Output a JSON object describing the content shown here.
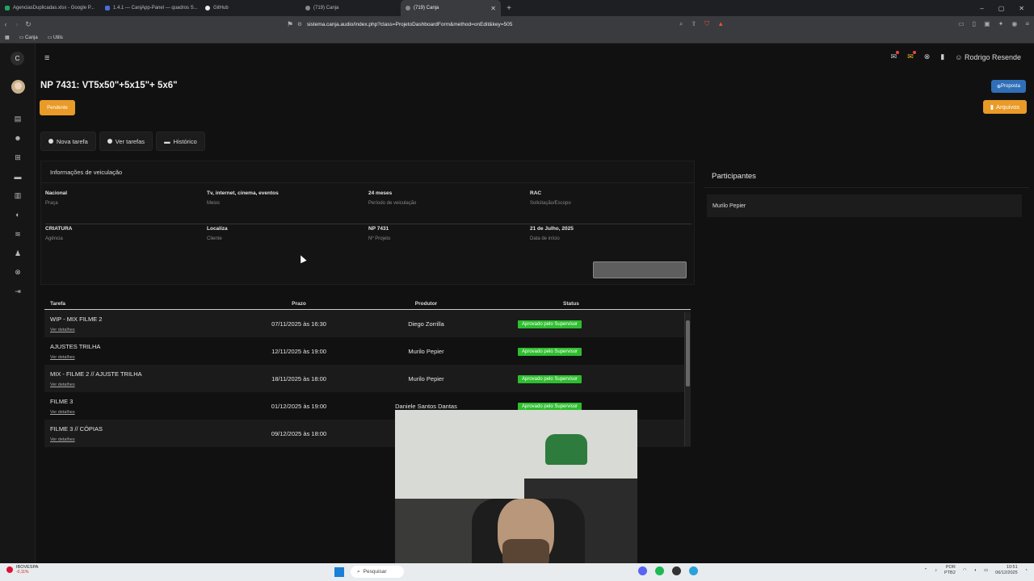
{
  "browser": {
    "tabs": [
      {
        "label": "AgenciasDuplicadas.xlsx - Google P...",
        "color": "#1fa463"
      },
      {
        "label": "1.4.1 — CanjApp-Panel — quadros S...",
        "color": "#4d6bdb"
      },
      {
        "label": "GitHub",
        "color": "#eeeeee"
      },
      {
        "label": "(719) Canja",
        "color": "#888888"
      },
      {
        "label": "(719) Canja",
        "color": "#888888"
      }
    ],
    "url": "sistema.canja.audio/index.php?class=ProjetoDashboardForm&method=onEdit&key=505",
    "bookmarks": [
      "Canja",
      "Utils"
    ]
  },
  "app": {
    "logo_letter": "C",
    "user_name": "Rodrigo Resende",
    "page_title": "NP 7431: VT5x50\"+5x15\"+ 5x6\"",
    "status_button": "Pendente",
    "proposta_button": "Proposta",
    "arquivos_button": "Arquivos",
    "actions": [
      "Nova tarefa",
      "Ver tarefas",
      "Histórico"
    ],
    "info_section_title": "Informações de veiculação",
    "info": [
      [
        {
          "value": "Nacional",
          "label": "Praça"
        },
        {
          "value": "Tv, internet, cinema, eventos",
          "label": "Meios"
        },
        {
          "value": "24 meses",
          "label": "Período de veiculação"
        },
        {
          "value": "RAC",
          "label": "Solicitação/Escopo"
        }
      ],
      [
        {
          "value": "CRIATURA",
          "label": "Agência"
        },
        {
          "value": "Localiza",
          "label": "Cliente"
        },
        {
          "value": "NP 7431",
          "label": "Nº Projeto"
        },
        {
          "value": "21 de Julho, 2025",
          "label": "Data de início"
        }
      ]
    ],
    "tasks_headers": [
      "Tarefa",
      "Prazo",
      "Produtor",
      "Status"
    ],
    "tasks_link": "Ver detalhes",
    "tasks": [
      {
        "name": "WIP - MIX FILME 2",
        "deadline": "07/11/2025 às 16:30",
        "producer": "Diego Zorrilla",
        "status": "Aprovado pelo Supervisor"
      },
      {
        "name": "AJUSTES TRILHA",
        "deadline": "12/11/2025 às 19:00",
        "producer": "Murilo Pepier",
        "status": "Aprovado pelo Supervisor"
      },
      {
        "name": "MIX - FILME 2 // AJUSTE TRILHA",
        "deadline": "18/11/2025 às 18:00",
        "producer": "Murilo Pepier",
        "status": "Aprovado pelo Supervisor"
      },
      {
        "name": "FILME 3",
        "deadline": "01/12/2025 às 19:00",
        "producer": "Daniele Santos Dantas",
        "status": "Aprovado pelo Supervisor"
      },
      {
        "name": "FILME 3 // CÓPIAS",
        "deadline": "09/12/2025 às 18:00",
        "producer": "",
        "status": ""
      }
    ],
    "participants_title": "Participantes",
    "participants": [
      "Murilo Pepier"
    ]
  },
  "taskbar": {
    "stock_name": "IBOVESPA",
    "stock_change": "-0,11%",
    "search_placeholder": "Pesquisar",
    "lang_top": "POR",
    "lang_bottom": "PTB2",
    "time": "10:51",
    "date": "06/12/2025"
  },
  "colors": {
    "accent_orange": "#e99a27",
    "accent_blue": "#2f6fb7",
    "status_green": "#2fbe2f"
  }
}
